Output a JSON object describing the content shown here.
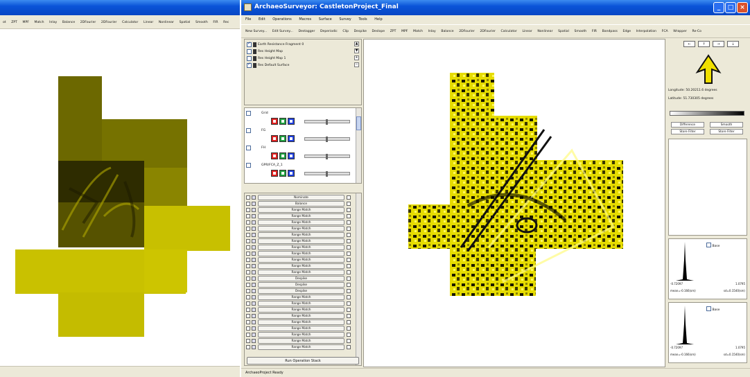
{
  "left_window": {
    "toolbar_items": [
      "ot",
      "ZPT",
      "MPF",
      "Match",
      "Inlay",
      "Balance",
      "2DFourier",
      "2DFourier",
      "Calculator",
      "Linear",
      "Nonlinear",
      "Spatial",
      "Smooth",
      "FIR",
      "Rec"
    ]
  },
  "main_window": {
    "title": "ArchaeoSurveyor: CastletonProject_Final",
    "title_buttons": {
      "minimize": "_",
      "maximize": "□",
      "close": "×"
    },
    "menu": [
      "File",
      "Edit",
      "Operations",
      "Macros",
      "Surface",
      "Survey",
      "Tools",
      "Help"
    ],
    "toolbar": [
      "New Survey...",
      "Edit Survey...",
      "Destagger",
      "Deperiodic",
      "Clip",
      "Despike",
      "Deslope",
      "ZPT",
      "MPF",
      "Match",
      "Inlay",
      "Balance",
      "2DFourier",
      "2DFourier",
      "Calculator",
      "Linear",
      "Nonlinear",
      "Spatial",
      "Smooth",
      "FIR",
      "Bandpass",
      "Edge",
      "Interpolation",
      "FCA",
      "Wrapper",
      "Re-Co"
    ],
    "layers": [
      {
        "label": "Earth Resistance Fragment 0",
        "checked": true
      },
      {
        "label": "Res Height Map",
        "checked": false
      },
      {
        "label": "Res Height Map 1",
        "checked": false
      },
      {
        "label": "Res Default Surface",
        "checked": true
      }
    ],
    "channels": [
      "Grid",
      "FG",
      "FH",
      "GPR/FCA_Z_1"
    ],
    "operations": [
      "Nominate",
      "Balance",
      "Range Match",
      "Range Match",
      "Range Match",
      "Range Match",
      "Range Match",
      "Range Match",
      "Range Match",
      "Range Match",
      "Range Match",
      "Range Match",
      "Range Match",
      "Despike",
      "Despike",
      "Despike",
      "Range Match",
      "Range Match",
      "Range Match",
      "Range Match",
      "Range Match",
      "Range Match",
      "Range Match",
      "Range Match",
      "Range Match"
    ],
    "run_button": "Run Operation Stack",
    "nav_buttons": [
      "←",
      "↑",
      "→",
      "↓"
    ],
    "longitude": "Longitude: 50.20211.6 degrees",
    "latitude": "Latitude: 51.730305 degrees",
    "rp_buttons": [
      "Difference",
      "Smooth",
      "Store Filter",
      "Store Filter"
    ],
    "histograms": [
      {
        "label": "Base",
        "min": "-0.72097",
        "max": "1.0795",
        "mean": "mean=-0.166(sm)",
        "sd": "sd=0.1540(sm)"
      },
      {
        "label": "Base",
        "min": "-0.72097",
        "max": "1.0795",
        "mean": "mean=-0.166(sm)",
        "sd": "sd=0.1540(sm)"
      }
    ],
    "status": "ArchaeoProject Ready"
  },
  "colors": {
    "titlebar": "#0a54d8",
    "chrome": "#ece9d8",
    "map_yellow": "#e8e000",
    "map_olive": "#6f6b00"
  },
  "icons": {
    "north_arrow": "north-arrow-icon",
    "app": "app-icon"
  }
}
